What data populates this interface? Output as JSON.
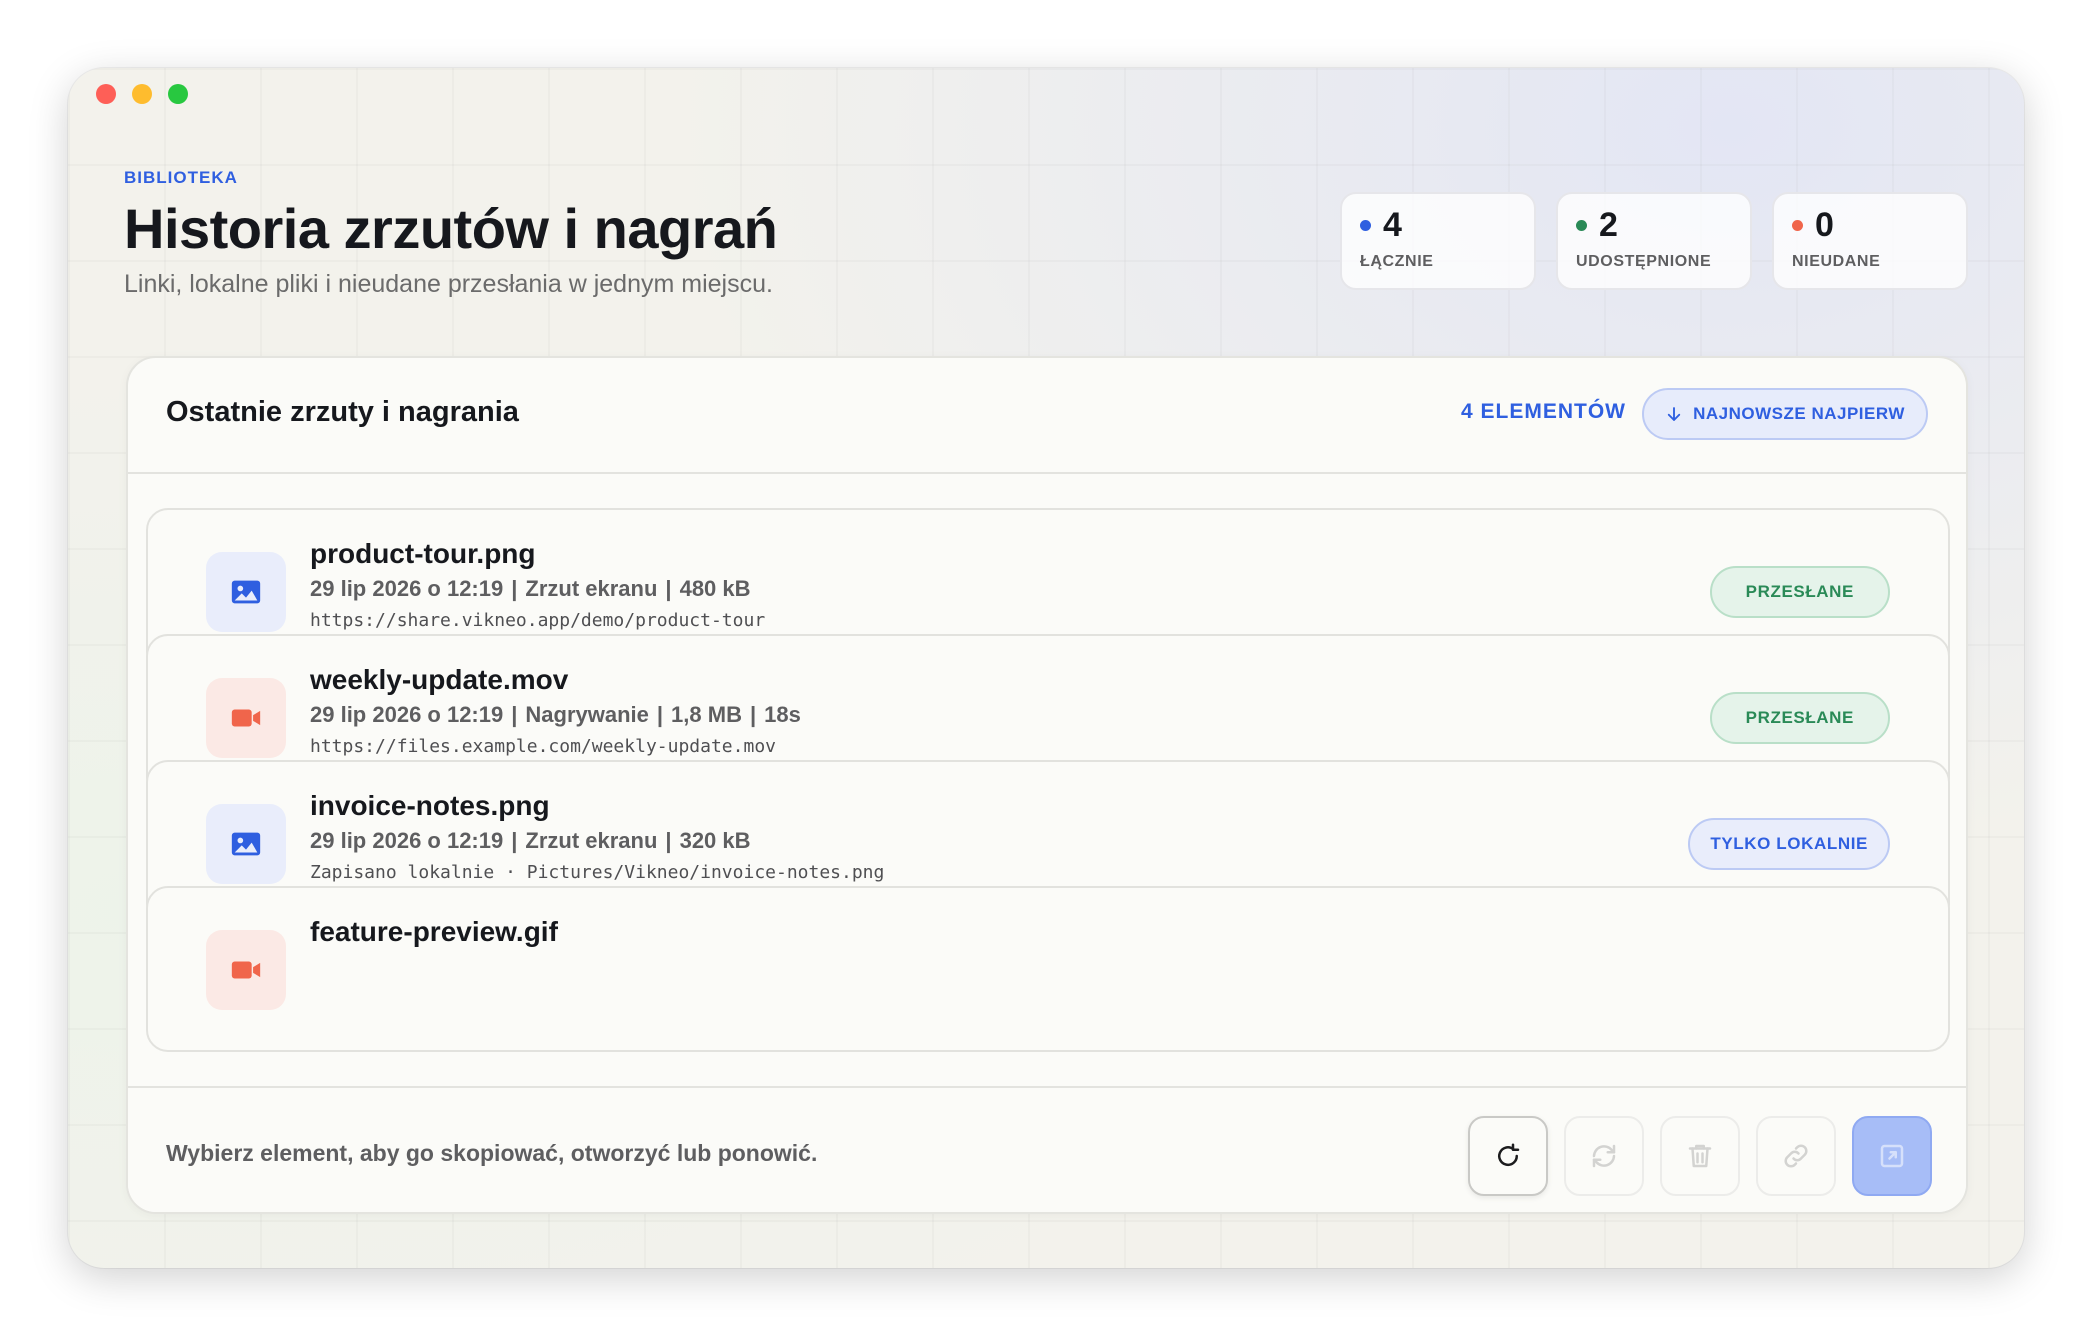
{
  "window": {
    "controls": [
      "close",
      "minimize",
      "zoom"
    ]
  },
  "header": {
    "eyebrow": "BIBLIOTEKA",
    "title": "Historia zrzutów i nagrań",
    "subtitle": "Linki, lokalne pliki i nieudane przesłania w jednym miejscu."
  },
  "stats": [
    {
      "value": "4",
      "label": "ŁĄCZNIE",
      "color": "#2f5fe0"
    },
    {
      "value": "2",
      "label": "UDOSTĘPNIONE",
      "color": "#2a8a57"
    },
    {
      "value": "0",
      "label": "NIEUDANE",
      "color": "#f0654b"
    }
  ],
  "panel": {
    "title": "Ostatnie zrzuty i nagrania",
    "count_label": "4 ELEMENTÓW",
    "sort_label": "NAJNOWSZE NAJPIERW",
    "sort_icon": "arrow-down-icon"
  },
  "items": [
    {
      "name": "product-tour.png",
      "meta": [
        "29 lip 2026 o 12:19",
        "Zrzut ekranu",
        "480 kB"
      ],
      "link": "https://share.vikneo.app/demo/product-tour",
      "status": "PRZESŁANE",
      "icon": "image-icon"
    },
    {
      "name": "weekly-update.mov",
      "meta": [
        "29 lip 2026 o 12:19",
        "Nagrywanie",
        "1,8 MB",
        "18s"
      ],
      "link": "https://files.example.com/weekly-update.mov",
      "status": "PRZESŁANE",
      "icon": "video-camera-icon"
    },
    {
      "name": "invoice-notes.png",
      "meta": [
        "29 lip 2026 o 12:19",
        "Zrzut ekranu",
        "320 kB"
      ],
      "link": "Zapisano lokalnie · Pictures/Vikneo/invoice-notes.png",
      "status": "TYLKO LOKALNIE",
      "icon": "image-icon"
    },
    {
      "name": "feature-preview.gif",
      "icon": "video-camera-icon"
    }
  ],
  "footer": {
    "hint": "Wybierz element, aby go skopiować, otworzyć lub ponowić.",
    "tools": [
      "refresh-icon",
      "retry-icon",
      "trash-icon",
      "link-icon",
      "open-external-icon"
    ]
  },
  "colors": {
    "accent": "#2f5fe0",
    "success": "#2a8a57",
    "danger": "#f0654b",
    "primary_button": "#a7bdf7"
  }
}
